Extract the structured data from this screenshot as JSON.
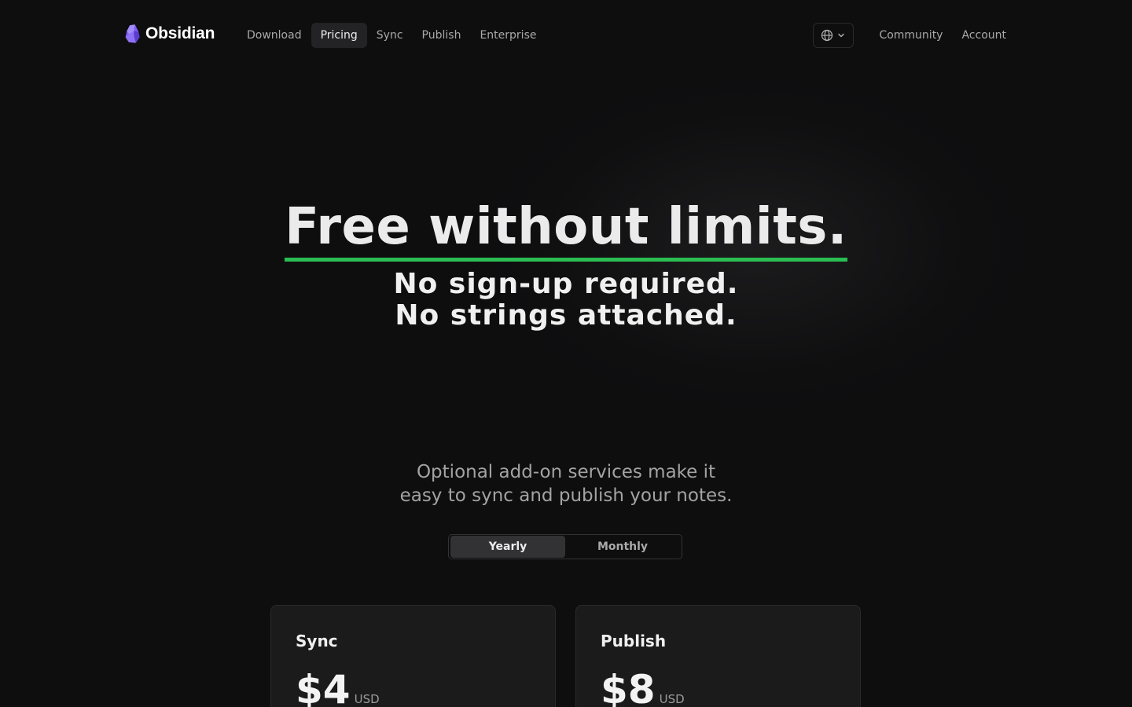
{
  "nav": {
    "brand": "Obsidian",
    "links": [
      {
        "label": "Download"
      },
      {
        "label": "Pricing",
        "active": true
      },
      {
        "label": "Sync"
      },
      {
        "label": "Publish"
      },
      {
        "label": "Enterprise"
      }
    ],
    "language_icon": "globe-icon",
    "right_links": [
      {
        "label": "Community"
      },
      {
        "label": "Account"
      }
    ]
  },
  "hero": {
    "title": "Free without limits.",
    "subtitle_line1": "No sign-up required.",
    "subtitle_line2": "No strings attached."
  },
  "addons": {
    "line1": "Optional add-on services make it",
    "line2": "easy to sync and publish your notes."
  },
  "billing_toggle": {
    "options": [
      "Yearly",
      "Monthly"
    ],
    "selected": "Yearly"
  },
  "plans": [
    {
      "name": "Sync",
      "price": "$4",
      "currency": "USD"
    },
    {
      "name": "Publish",
      "price": "$8",
      "currency": "USD"
    }
  ],
  "colors": {
    "background": "#0e0e0f",
    "accent_underline": "#2bbd52",
    "logo_purple": "#8b6cf0"
  }
}
